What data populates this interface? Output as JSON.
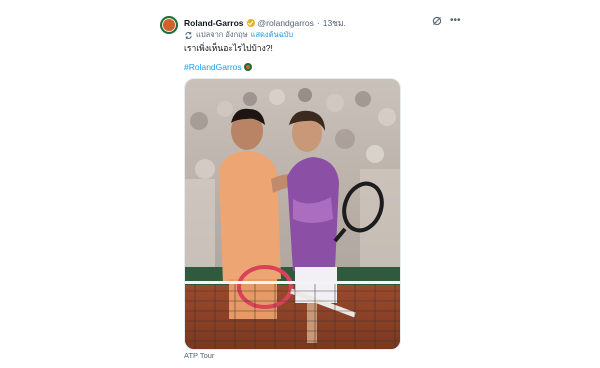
{
  "tweet": {
    "display_name": "Roland-Garros",
    "handle": "@rolandgarros",
    "separator": "·",
    "time": "13ชม.",
    "translated_from": "แปลจาก อังกฤษ",
    "show_original": "แสดงต้นฉบับ",
    "text": "เราเพิ่งเห็นอะไรไปบ้าง?!",
    "hashtag": "#RolandGarros",
    "media_caption": "ATP Tour"
  },
  "icons": {
    "avatar": "roland-garros-logo",
    "verified": "gold-verified-badge",
    "grok": "grok-icon",
    "more": "more-icon",
    "translate": "translate-icon"
  },
  "colors": {
    "link": "#1d9bf0",
    "secondary_text": "#536471",
    "verified_gold": "#e2b230",
    "brand_green": "#1e6b3c",
    "clay_orange": "#d2602e"
  }
}
